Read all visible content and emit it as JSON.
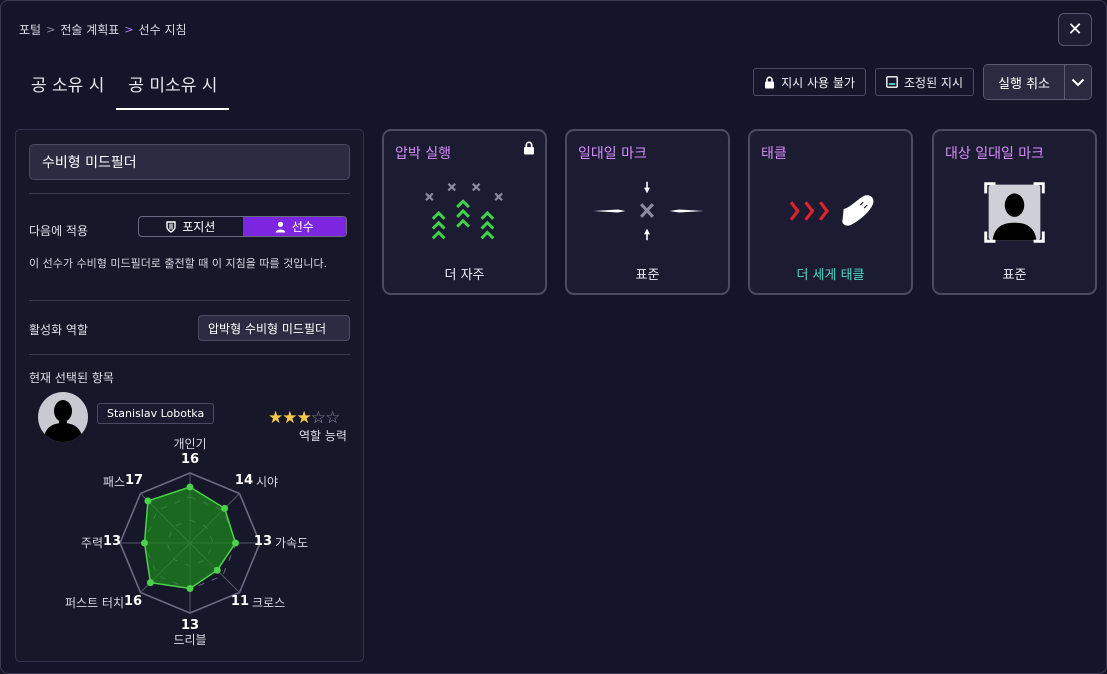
{
  "breadcrumb": [
    "포털",
    "전술 계획표",
    "선수 지침"
  ],
  "close_label": "✕",
  "tabs": [
    {
      "label": "공 소유 시",
      "active": false
    },
    {
      "label": "공 미소유 시",
      "active": true
    }
  ],
  "actions": {
    "unavailable": "지시 사용 불가",
    "adjusted": "조정된 지시",
    "cancel": "실행 취소"
  },
  "left": {
    "role_name": "수비형 미드필더",
    "apply_label": "다음에 적용",
    "apply_options": [
      "포지션",
      "선수"
    ],
    "apply_selected": "선수",
    "apply_desc": "이 선수가 수비형 미드필더로 출전할 때 이 지침을 따를 것입니다.",
    "active_role_label": "활성화 역할",
    "active_role_value": "압박형 수비형 미드필더",
    "current_label": "현재 선택된 항목",
    "player_name": "Stanislav Lobotka",
    "stars_filled": 3,
    "stars_total": 5,
    "role_ability_label": "역할 능력"
  },
  "radar": {
    "max": 20,
    "attributes": [
      {
        "label": "개인기",
        "value": 16
      },
      {
        "label": "시야",
        "value": 14
      },
      {
        "label": "가속도",
        "value": 13
      },
      {
        "label": "크로스",
        "value": 11
      },
      {
        "label": "드리블",
        "value": 13
      },
      {
        "label": "퍼스트 터치",
        "value": 16
      },
      {
        "label": "주력",
        "value": 13
      },
      {
        "label": "패스",
        "value": 17
      }
    ],
    "fill_color": "#1e8c1e",
    "line_color": "#4bd14b"
  },
  "cards": [
    {
      "title": "압박 실행",
      "value": "더 자주",
      "locked": true,
      "teal": false,
      "icon": "press-icon"
    },
    {
      "title": "일대일 마크",
      "value": "표준",
      "locked": false,
      "teal": false,
      "icon": "mark-icon"
    },
    {
      "title": "태클",
      "value": "더 세게 태클",
      "locked": false,
      "teal": true,
      "icon": "tackle-icon"
    },
    {
      "title": "대상 일대일 마크",
      "value": "표준",
      "locked": false,
      "teal": false,
      "icon": "target-mark-icon"
    }
  ]
}
